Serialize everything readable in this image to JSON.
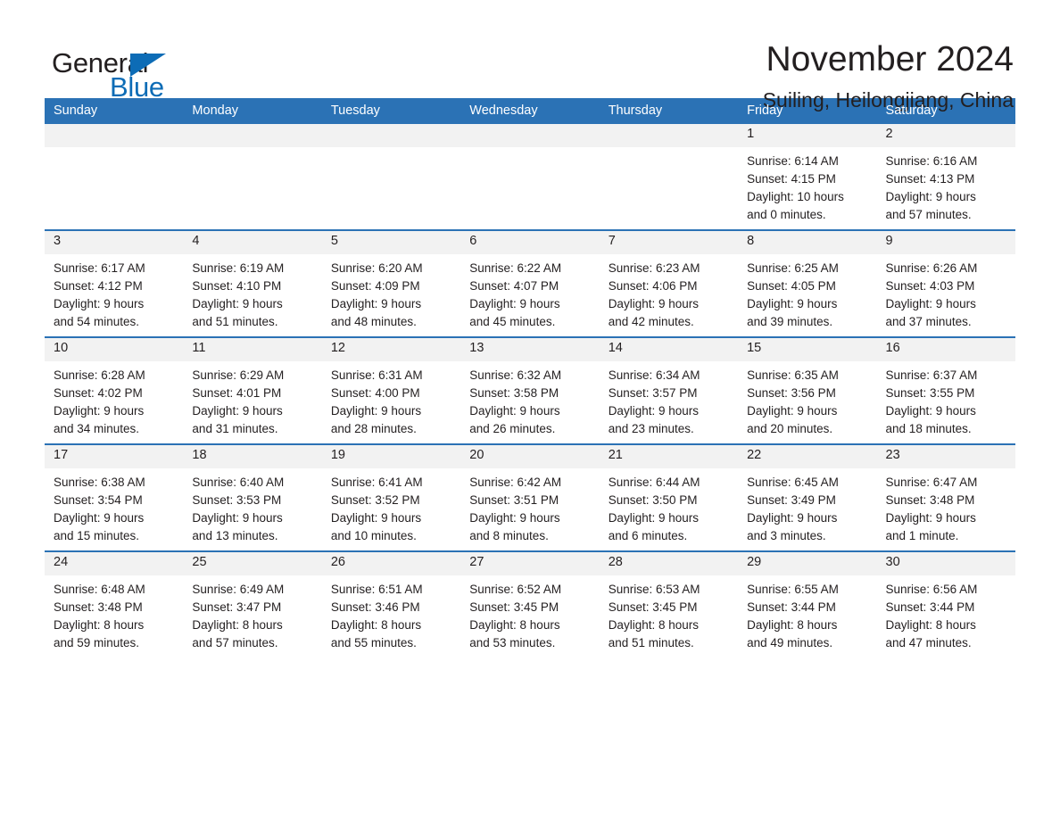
{
  "brand": {
    "word_one": "General",
    "word_two": "Blue",
    "accent_color": "#0d6cb6"
  },
  "header": {
    "month_title": "November 2024",
    "location": "Suiling, Heilongjiang, China",
    "header_bg_color": "#2b72b5",
    "daynum_bg_color": "#f2f2f2"
  },
  "weekday_headers": [
    "Sunday",
    "Monday",
    "Tuesday",
    "Wednesday",
    "Thursday",
    "Friday",
    "Saturday"
  ],
  "weeks": [
    [
      {
        "day": "",
        "empty": true,
        "sunrise": "",
        "sunset": "",
        "daylight_1": "",
        "daylight_2": ""
      },
      {
        "day": "",
        "empty": true,
        "sunrise": "",
        "sunset": "",
        "daylight_1": "",
        "daylight_2": ""
      },
      {
        "day": "",
        "empty": true,
        "sunrise": "",
        "sunset": "",
        "daylight_1": "",
        "daylight_2": ""
      },
      {
        "day": "",
        "empty": true,
        "sunrise": "",
        "sunset": "",
        "daylight_1": "",
        "daylight_2": ""
      },
      {
        "day": "",
        "empty": true,
        "sunrise": "",
        "sunset": "",
        "daylight_1": "",
        "daylight_2": ""
      },
      {
        "day": "1",
        "empty": false,
        "sunrise": "Sunrise: 6:14 AM",
        "sunset": "Sunset: 4:15 PM",
        "daylight_1": "Daylight: 10 hours",
        "daylight_2": "and 0 minutes."
      },
      {
        "day": "2",
        "empty": false,
        "sunrise": "Sunrise: 6:16 AM",
        "sunset": "Sunset: 4:13 PM",
        "daylight_1": "Daylight: 9 hours",
        "daylight_2": "and 57 minutes."
      }
    ],
    [
      {
        "day": "3",
        "empty": false,
        "sunrise": "Sunrise: 6:17 AM",
        "sunset": "Sunset: 4:12 PM",
        "daylight_1": "Daylight: 9 hours",
        "daylight_2": "and 54 minutes."
      },
      {
        "day": "4",
        "empty": false,
        "sunrise": "Sunrise: 6:19 AM",
        "sunset": "Sunset: 4:10 PM",
        "daylight_1": "Daylight: 9 hours",
        "daylight_2": "and 51 minutes."
      },
      {
        "day": "5",
        "empty": false,
        "sunrise": "Sunrise: 6:20 AM",
        "sunset": "Sunset: 4:09 PM",
        "daylight_1": "Daylight: 9 hours",
        "daylight_2": "and 48 minutes."
      },
      {
        "day": "6",
        "empty": false,
        "sunrise": "Sunrise: 6:22 AM",
        "sunset": "Sunset: 4:07 PM",
        "daylight_1": "Daylight: 9 hours",
        "daylight_2": "and 45 minutes."
      },
      {
        "day": "7",
        "empty": false,
        "sunrise": "Sunrise: 6:23 AM",
        "sunset": "Sunset: 4:06 PM",
        "daylight_1": "Daylight: 9 hours",
        "daylight_2": "and 42 minutes."
      },
      {
        "day": "8",
        "empty": false,
        "sunrise": "Sunrise: 6:25 AM",
        "sunset": "Sunset: 4:05 PM",
        "daylight_1": "Daylight: 9 hours",
        "daylight_2": "and 39 minutes."
      },
      {
        "day": "9",
        "empty": false,
        "sunrise": "Sunrise: 6:26 AM",
        "sunset": "Sunset: 4:03 PM",
        "daylight_1": "Daylight: 9 hours",
        "daylight_2": "and 37 minutes."
      }
    ],
    [
      {
        "day": "10",
        "empty": false,
        "sunrise": "Sunrise: 6:28 AM",
        "sunset": "Sunset: 4:02 PM",
        "daylight_1": "Daylight: 9 hours",
        "daylight_2": "and 34 minutes."
      },
      {
        "day": "11",
        "empty": false,
        "sunrise": "Sunrise: 6:29 AM",
        "sunset": "Sunset: 4:01 PM",
        "daylight_1": "Daylight: 9 hours",
        "daylight_2": "and 31 minutes."
      },
      {
        "day": "12",
        "empty": false,
        "sunrise": "Sunrise: 6:31 AM",
        "sunset": "Sunset: 4:00 PM",
        "daylight_1": "Daylight: 9 hours",
        "daylight_2": "and 28 minutes."
      },
      {
        "day": "13",
        "empty": false,
        "sunrise": "Sunrise: 6:32 AM",
        "sunset": "Sunset: 3:58 PM",
        "daylight_1": "Daylight: 9 hours",
        "daylight_2": "and 26 minutes."
      },
      {
        "day": "14",
        "empty": false,
        "sunrise": "Sunrise: 6:34 AM",
        "sunset": "Sunset: 3:57 PM",
        "daylight_1": "Daylight: 9 hours",
        "daylight_2": "and 23 minutes."
      },
      {
        "day": "15",
        "empty": false,
        "sunrise": "Sunrise: 6:35 AM",
        "sunset": "Sunset: 3:56 PM",
        "daylight_1": "Daylight: 9 hours",
        "daylight_2": "and 20 minutes."
      },
      {
        "day": "16",
        "empty": false,
        "sunrise": "Sunrise: 6:37 AM",
        "sunset": "Sunset: 3:55 PM",
        "daylight_1": "Daylight: 9 hours",
        "daylight_2": "and 18 minutes."
      }
    ],
    [
      {
        "day": "17",
        "empty": false,
        "sunrise": "Sunrise: 6:38 AM",
        "sunset": "Sunset: 3:54 PM",
        "daylight_1": "Daylight: 9 hours",
        "daylight_2": "and 15 minutes."
      },
      {
        "day": "18",
        "empty": false,
        "sunrise": "Sunrise: 6:40 AM",
        "sunset": "Sunset: 3:53 PM",
        "daylight_1": "Daylight: 9 hours",
        "daylight_2": "and 13 minutes."
      },
      {
        "day": "19",
        "empty": false,
        "sunrise": "Sunrise: 6:41 AM",
        "sunset": "Sunset: 3:52 PM",
        "daylight_1": "Daylight: 9 hours",
        "daylight_2": "and 10 minutes."
      },
      {
        "day": "20",
        "empty": false,
        "sunrise": "Sunrise: 6:42 AM",
        "sunset": "Sunset: 3:51 PM",
        "daylight_1": "Daylight: 9 hours",
        "daylight_2": "and 8 minutes."
      },
      {
        "day": "21",
        "empty": false,
        "sunrise": "Sunrise: 6:44 AM",
        "sunset": "Sunset: 3:50 PM",
        "daylight_1": "Daylight: 9 hours",
        "daylight_2": "and 6 minutes."
      },
      {
        "day": "22",
        "empty": false,
        "sunrise": "Sunrise: 6:45 AM",
        "sunset": "Sunset: 3:49 PM",
        "daylight_1": "Daylight: 9 hours",
        "daylight_2": "and 3 minutes."
      },
      {
        "day": "23",
        "empty": false,
        "sunrise": "Sunrise: 6:47 AM",
        "sunset": "Sunset: 3:48 PM",
        "daylight_1": "Daylight: 9 hours",
        "daylight_2": "and 1 minute."
      }
    ],
    [
      {
        "day": "24",
        "empty": false,
        "sunrise": "Sunrise: 6:48 AM",
        "sunset": "Sunset: 3:48 PM",
        "daylight_1": "Daylight: 8 hours",
        "daylight_2": "and 59 minutes."
      },
      {
        "day": "25",
        "empty": false,
        "sunrise": "Sunrise: 6:49 AM",
        "sunset": "Sunset: 3:47 PM",
        "daylight_1": "Daylight: 8 hours",
        "daylight_2": "and 57 minutes."
      },
      {
        "day": "26",
        "empty": false,
        "sunrise": "Sunrise: 6:51 AM",
        "sunset": "Sunset: 3:46 PM",
        "daylight_1": "Daylight: 8 hours",
        "daylight_2": "and 55 minutes."
      },
      {
        "day": "27",
        "empty": false,
        "sunrise": "Sunrise: 6:52 AM",
        "sunset": "Sunset: 3:45 PM",
        "daylight_1": "Daylight: 8 hours",
        "daylight_2": "and 53 minutes."
      },
      {
        "day": "28",
        "empty": false,
        "sunrise": "Sunrise: 6:53 AM",
        "sunset": "Sunset: 3:45 PM",
        "daylight_1": "Daylight: 8 hours",
        "daylight_2": "and 51 minutes."
      },
      {
        "day": "29",
        "empty": false,
        "sunrise": "Sunrise: 6:55 AM",
        "sunset": "Sunset: 3:44 PM",
        "daylight_1": "Daylight: 8 hours",
        "daylight_2": "and 49 minutes."
      },
      {
        "day": "30",
        "empty": false,
        "sunrise": "Sunrise: 6:56 AM",
        "sunset": "Sunset: 3:44 PM",
        "daylight_1": "Daylight: 8 hours",
        "daylight_2": "and 47 minutes."
      }
    ]
  ]
}
